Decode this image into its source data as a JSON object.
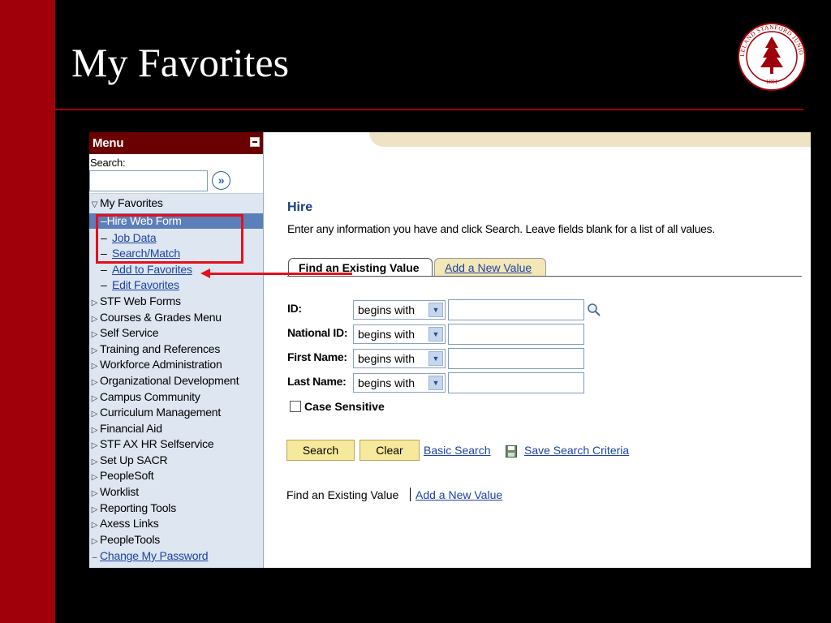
{
  "slide": {
    "title": "My Favorites",
    "seal_text": "LELAND STANFORD JUNIOR UNIVERSITY",
    "seal_year": "1891"
  },
  "menu": {
    "title": "Menu",
    "search_label": "Search:",
    "search_button": "»",
    "favorites": {
      "label": "My Favorites",
      "items": [
        "Hire Web Form",
        "Job Data",
        "Search/Match",
        "Add to Favorites",
        "Edit Favorites"
      ]
    },
    "folders": [
      "STF Web Forms",
      "Courses & Grades Menu",
      "Self Service",
      "Training and References",
      "Workforce Administration",
      "Organizational Development",
      "Campus Community",
      "Curriculum Management",
      "Financial Aid",
      "STF AX HR Selfservice",
      "Set Up SACR",
      "PeopleSoft",
      "Worklist",
      "Reporting Tools",
      "Axess Links",
      "PeopleTools"
    ],
    "change_password": "Change My Password"
  },
  "page": {
    "heading": "Hire",
    "instructions": "Enter any information you have and click Search. Leave fields blank for a list of all values.",
    "tabs": [
      "Find an Existing Value",
      "Add a New Value"
    ],
    "fields": [
      {
        "label": "ID:",
        "operator": "begins with",
        "value": ""
      },
      {
        "label": "National ID:",
        "operator": "begins with",
        "value": ""
      },
      {
        "label": "First Name:",
        "operator": "begins with",
        "value": ""
      },
      {
        "label": "Last Name:",
        "operator": "begins with",
        "value": ""
      }
    ],
    "case_sensitive_label": "Case Sensitive",
    "buttons": {
      "search": "Search",
      "clear": "Clear"
    },
    "basic_search_link": "Basic Search",
    "save_criteria_link": "Save Search Criteria",
    "footer_text": "Find an Existing Value",
    "footer_link": "Add a New Value"
  },
  "colors": {
    "accent": "#a0000a",
    "selected": "#5b7fb9",
    "link": "#1d43a3",
    "button": "#f6e99b"
  },
  "icons": [
    "collapse-icon",
    "go-icon",
    "triangle-icon",
    "dropdown-arrow-icon",
    "lookup-magnifier-icon",
    "save-disk-icon",
    "arrow-annotation"
  ]
}
